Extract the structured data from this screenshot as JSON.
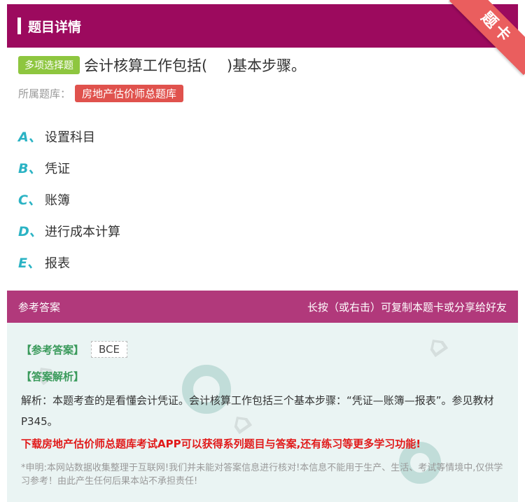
{
  "header": {
    "title": "题目详情"
  },
  "ribbon": {
    "label": "题卡"
  },
  "question": {
    "type": "多项选择题",
    "text": "会计核算工作包括(　 )基本步骤。",
    "bank_label": "所属题库：",
    "bank_name": "房地产估价师总题库",
    "options": [
      {
        "letter": "A、",
        "text": "设置科目"
      },
      {
        "letter": "B、",
        "text": "凭证"
      },
      {
        "letter": "C、",
        "text": "账簿"
      },
      {
        "letter": "D、",
        "text": "进行成本计算"
      },
      {
        "letter": "E、",
        "text": "报表"
      }
    ]
  },
  "answer": {
    "section_title": "参考答案",
    "copy_hint": "长按（或右击）可复制本题卡或分享给好友",
    "answer_label": "【参考答案】",
    "answer_value": "BCE",
    "analysis_label": "【答案解析】",
    "analysis_text": "解析：本题考查的是看懂会计凭证。会计核算工作包括三个基本步骤：“凭证—账簿—报表”。参见教材P345。",
    "promo_text": "下载房地产估价师总题库考试APP可以获得系列题目与答案,还有练习等更多学习功能!",
    "disclaimer": "*申明:本网站数据收集整理于互联网!我们并未能对答案信息进行核对!本信息不能用于生产、生活、考试等情境中,仅供学习参考！由此产生任何后果本站不承担责任!"
  },
  "colors": {
    "header_bg": "#9c0a5e",
    "answer_header_bg": "#b1397b",
    "qtype_tag": "#8ec63f",
    "bank_tag": "#e0524d",
    "option_letter": "#2bb3c4",
    "answer_label": "#3a9a5b",
    "promo": "#e11a1a"
  }
}
